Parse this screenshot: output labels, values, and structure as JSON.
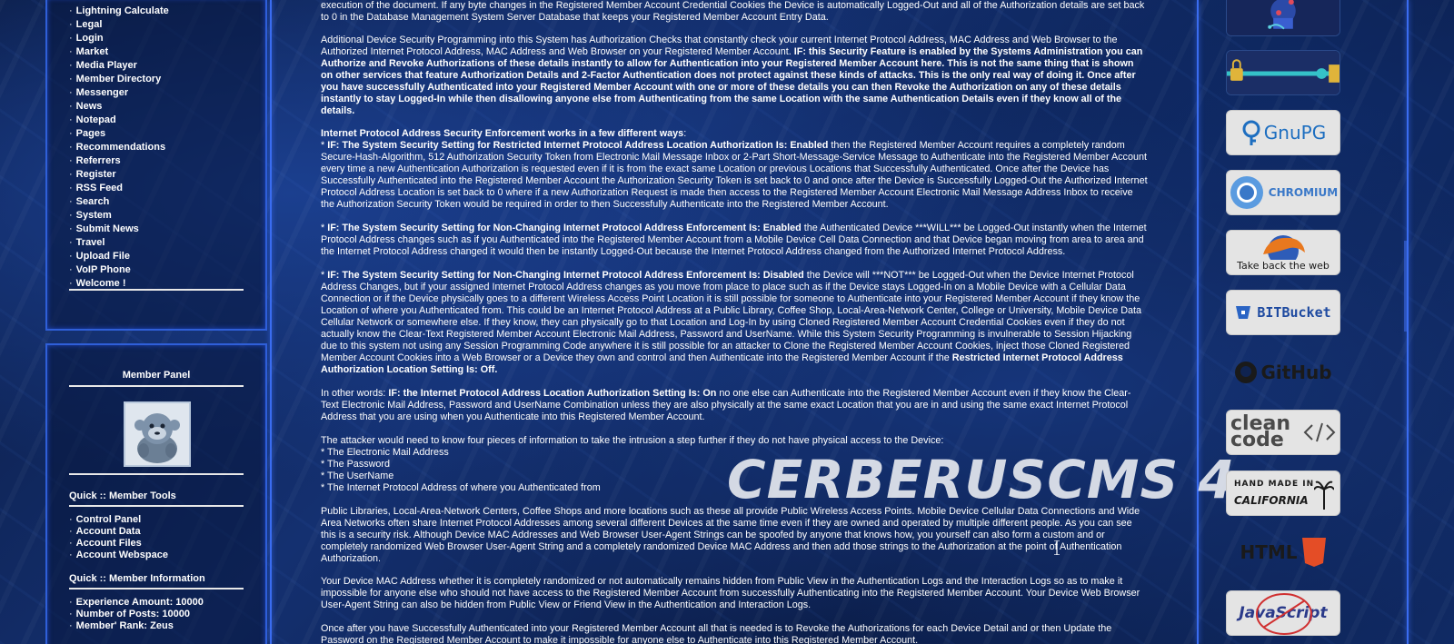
{
  "nav": {
    "items": [
      "Lightning Calculate",
      "Legal",
      "Login",
      "Market",
      "Media Player",
      "Member Directory",
      "Messenger",
      "News",
      "Notepad",
      "Pages",
      "Recommendations",
      "Referrers",
      "Register",
      "RSS Feed",
      "Search",
      "System",
      "Submit News",
      "Travel",
      "Upload File",
      "VoIP Phone",
      "Welcome !"
    ]
  },
  "member_panel": {
    "title": "Member Panel",
    "avatar_icon": "gorilla-avatar-icon",
    "tools_heading": "Quick :: Member Tools",
    "tools": [
      "Control Panel",
      "Account Data",
      "Account Files",
      "Account Webspace"
    ],
    "info_heading": "Quick :: Member Information",
    "info": [
      "Experience Amount: 10000",
      "Number of Posts: 10000",
      "Member' Rank: Zeus"
    ]
  },
  "content": {
    "p0": "execution of the document. If any byte changes in the Registered Member Account Credential Cookies the Device is automatically Logged-Out and all of the Authorization details are set back to 0 in the Database Management System Server Database that keeps your Registered Member Account Entry Data.",
    "p1_normal": "Additional Device Security Programming into this System has Authorization Checks that constantly check your current Internet Protocol Address, MAC Address and Web Browser to the Authorized Internet Protocol Address, MAC Address and Web Browser on your Registered Member Account. ",
    "p1_bold": "IF: this Security Feature is enabled by the Systems Administration you can Authorize and Revoke Authorizations of these details instantly to allow for Authentication into your Registered Member Account here. This is not the same thing that is shown on other services that feature Authorization Details and 2-Factor Authentication does not protect against these kinds of attacks. This is the only real way of doing it. Once after you have successfully Authenticated into your Registered Member Account with one or more of these details you can then Revoke the Authorization on any of these details instantly to stay Logged-In while then disallowing anyone else from Authenticating from the same Location with the same Authentication Details even if they know all of the details.",
    "p2_bold": "Internet Protocol Address Security Enforcement works in a few different ways",
    "p2_colon": ":",
    "p2_star": "* ",
    "p2_bold2": "IF: The System Security Setting for Restricted Internet Protocol Address Location Authorization Is: Enabled",
    "p2_normal": " then the Registered Member Account requires a completely random Secure-Hash-Algorithm, 512 Authorization Security Token from Electronic Mail Message Inbox or 2-Part Short-Message-Service Message to Authenticate into the Registered Member Account every time a new Authentication Authorization is requested even if it is from the exact same Location or previous Locations that Successfully Authenticated. Once after the Device has Successfully Authenticated into the Registered Member Account the Authorization Security Token is set back to 0 and once after the Device is Successfully Logged-Out the Authorized Internet Protocol Address Location is set back to 0 where if a new Authorization Request is made then access to the Registered Member Account Electronic Mail Message Address Inbox to receive the Authorization Security Token would be required in order to then Successfully Authenticate into the Registered Member Account.",
    "p3_star": "* ",
    "p3_bold": "IF: The System Security Setting for Non-Changing Internet Protocol Address Enforcement Is: Enabled",
    "p3_normal": " the Authenticated Device ***WILL*** be Logged-Out instantly when the Internet Protocol Address changes such as if you Authenticated into the Registered Member Account from a Mobile Device Cell Data Connection and that Device began moving from area to area and the Internet Protocol Address changed it would then be instantly Logged-Out because the Internet Protocol Address changed from the Authorized Internet Protocol Address.",
    "p4_star": "* ",
    "p4_bold": "IF: The System Security Setting for Non-Changing Internet Protocol Address Enforcement Is: Disabled",
    "p4_normal": " the Device will ***NOT*** be Logged-Out when the Device Internet Protocol Address Changes, but if your assigned Internet Protocol Address changes as you move from place to place such as if the Device stays Logged-In on a Mobile Device with a Cellular Data Connection or if the Device physically goes to a different Wireless Access Point Location it is still possible for someone to Authenticate into your Registered Member Account if they know the Location of where you Authenticated from. This could be an Internet Protocol Address at a Public Library, Coffee Shop, Local-Area-Network Center, College or University, Mobile Device Data Cellular Network or somewhere else. If they know, they can physically go to that Location and Log-In by using Cloned Registered Member Account Credential Cookies even if they do not actually know the Clear-Text Registered Member Account Electronic Mail Address, Password and UserName. While this System Security Programming is invulnerable to Session Hijacking due to this system not using any Session Programming Code anywhere it is still possible for an attacker to Clone the Registered Member Account Cookies, inject those Cloned Registered Member Account Cookies into a Web Browser or a Device they own and control and then Authenticate into the Registered Member Account if the ",
    "p4_bold2": "Restricted Internet Protocol Address Authorization Location Setting Is: Off.",
    "p5_normal": "In other words: ",
    "p5_bold": "IF: the Internet Protocol Address Location Authorization Setting Is: On",
    "p5_normal2": " no one else can Authenticate into the Registered Member Account even if they know the Clear-Text Electronic Mail Address, Password and UserName Combination unless they are also physically at the same exact Location that you are in and using the same exact Internet Protocol Address that you are using when you Authenticate into this Registered Member Account.",
    "p6_lines": [
      "The attacker would need to know four pieces of information to take the intrusion a step further if they do not have physical access to the Device:",
      "* The Electronic Mail Address",
      "* The Password",
      "* The UserName",
      "* The Internet Protocol Address of where you Authenticated from"
    ],
    "p7": "Public Libraries, Local-Area-Network Centers, Coffee Shops and more locations such as these all provide Public Wireless Access Points. Mobile Device Cellular Data Connections and Wide Area Networks often share Internet Protocol Addresses among several different Devices at the same time even if they are owned and operated by multiple different people. As you can see this is a security risk. Although Device MAC Addresses and Web Browser User-Agent Strings can be spoofed by anyone that knows how, you yourself can also form a custom and or completely randomized Web Browser User-Agent String and a completely randomized Device MAC Address and then add those strings to the Authorization at the point of Authentication Authorization.",
    "p8": "Your Device MAC Address whether it is completely randomized or not automatically remains hidden from Public View in the Authentication Logs and the Interaction Logs so as to make it impossible for anyone else who should not have access to the Registered Member Account from successfully Authenticating into the Registered Member Account. Your Device Web Browser User-Agent String can also be hidden from Public View or Friend View in the Authentication and Interaction Logs.",
    "p9": "Once after you have Successfully Authenticated into your Registered Member Account all that is needed is to Revoke the Authorizations for each Device Detail and or then Update the Password on the Registered Member Account to make it impossible for anyone else to Authenticate into this Registered Member Account.",
    "watermark": "CERBERUSCMS 4"
  },
  "badges": [
    {
      "name": "hacker-badge",
      "label": ""
    },
    {
      "name": "padlock-badge",
      "label": ""
    },
    {
      "name": "gnupg-badge",
      "label": "GnuPG"
    },
    {
      "name": "chromium-badge",
      "label": "CHROMIUM"
    },
    {
      "name": "firefox-badge",
      "label": "Take back the web"
    },
    {
      "name": "bitbucket-badge",
      "label": "BITBucket"
    },
    {
      "name": "github-badge",
      "label": "GitHub"
    },
    {
      "name": "clean-code-badge",
      "label": "clean code"
    },
    {
      "name": "made-in-california-badge",
      "label1": "HAND MADE IN",
      "label2": "CALIFORNIA"
    },
    {
      "name": "html5-badge",
      "label": "HTML",
      "label5": "5"
    },
    {
      "name": "javascript-badge",
      "label": "JavaScript"
    }
  ]
}
